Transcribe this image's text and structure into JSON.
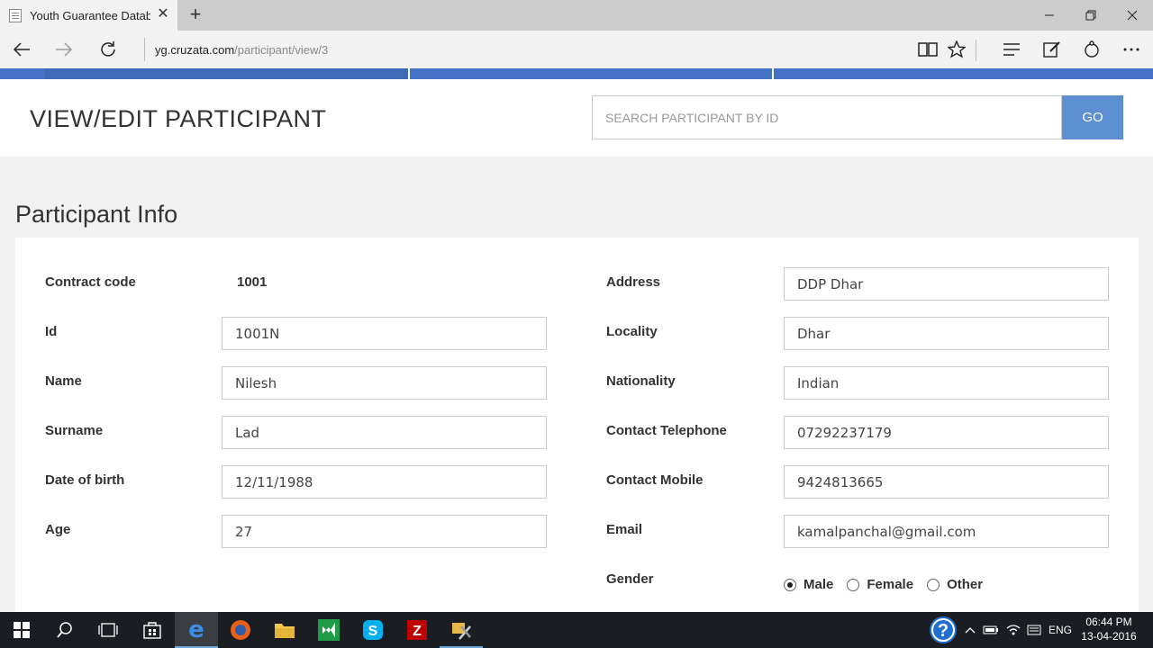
{
  "browser": {
    "tab_title": "Youth Guarantee Datab:",
    "url_host": "yg.cruzata.com",
    "url_path": "/participant/view/3"
  },
  "header": {
    "title": "VIEW/EDIT PARTICIPANT",
    "search_placeholder": "SEARCH PARTICIPANT BY ID",
    "go_label": "GO"
  },
  "section": {
    "title": "Participant Info"
  },
  "form": {
    "contract_code": {
      "label": "Contract code",
      "value": "1001"
    },
    "id": {
      "label": "Id",
      "value": "1001N"
    },
    "name": {
      "label": "Name",
      "value": "Nilesh"
    },
    "surname": {
      "label": "Surname",
      "value": "Lad"
    },
    "dob": {
      "label": "Date of birth",
      "value": "12/11/1988"
    },
    "age": {
      "label": "Age",
      "value": "27"
    },
    "address": {
      "label": "Address",
      "value": "DDP Dhar"
    },
    "locality": {
      "label": "Locality",
      "value": "Dhar"
    },
    "nationality": {
      "label": "Nationality",
      "value": "Indian"
    },
    "telephone": {
      "label": "Contact Telephone",
      "value": "07292237179"
    },
    "mobile": {
      "label": "Contact Mobile",
      "value": "9424813665"
    },
    "email": {
      "label": "Email",
      "value": "kamalpanchal@gmail.com"
    },
    "gender": {
      "label": "Gender",
      "options": [
        "Male",
        "Female",
        "Other"
      ],
      "selected": "Male"
    }
  },
  "taskbar": {
    "lang": "ENG",
    "time": "06:44 PM",
    "date": "13-04-2016"
  },
  "colors": {
    "accent": "#5b8fd1",
    "nav_strip": "#4472c4"
  }
}
